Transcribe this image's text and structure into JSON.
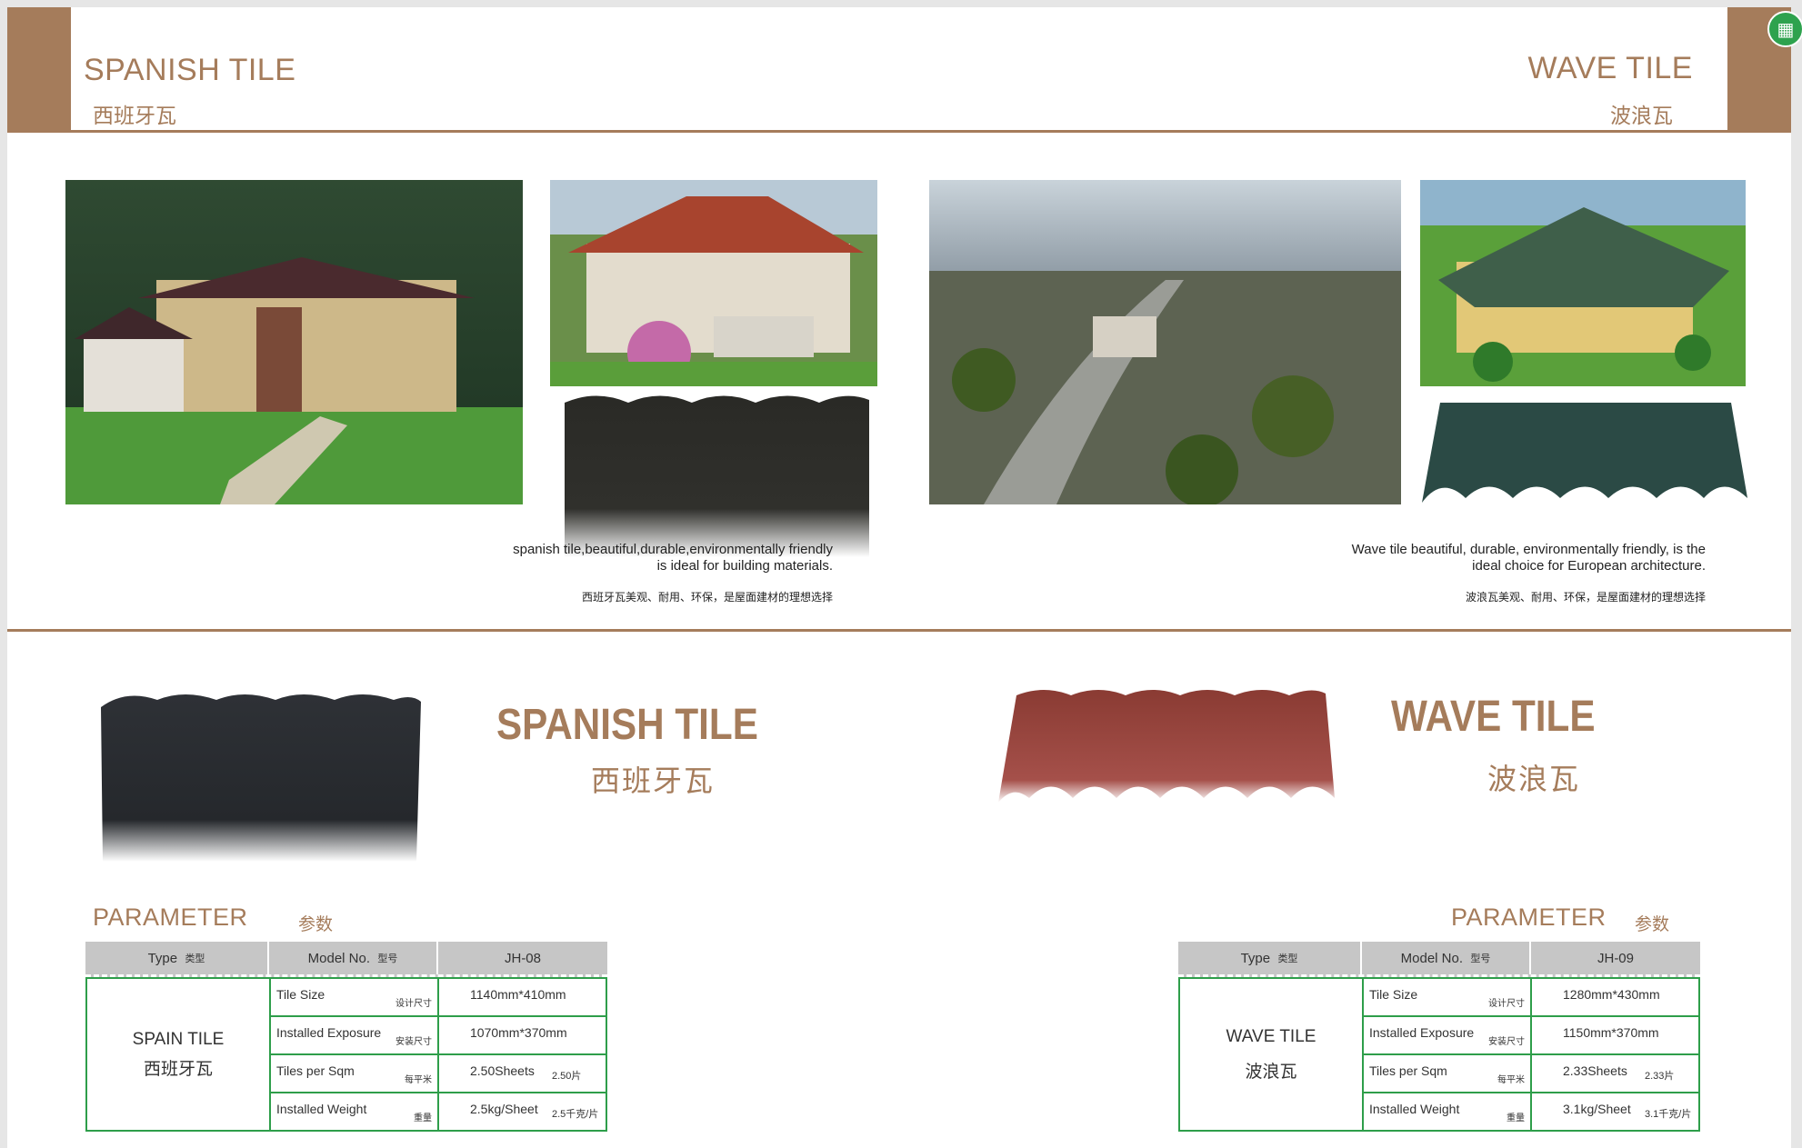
{
  "header": {
    "left_title_en": "SPANISH TILE",
    "left_title_cn": "西班牙瓦",
    "right_title_en": "WAVE TILE",
    "right_title_cn": "波浪瓦"
  },
  "captions": {
    "spanish_en_1": "spanish tile,beautiful,durable,environmentally friendly",
    "spanish_en_2": "is ideal for building materials.",
    "spanish_cn": "西班牙瓦美观、耐用、环保，是屋面建材的理想选择",
    "wave_en_1": "Wave tile beautiful, durable, environmentally friendly, is the",
    "wave_en_2": "ideal choice for European architecture.",
    "wave_cn": "波浪瓦美观、耐用、环保，是屋面建材的理想选择"
  },
  "products": {
    "spanish": {
      "title_en": "SPANISH TILE",
      "title_cn": "西班牙瓦"
    },
    "wave": {
      "title_en": "WAVE TILE",
      "title_cn": "波浪瓦"
    }
  },
  "param_label": {
    "en": "PARAMETER",
    "cn": "参数"
  },
  "table_headers": {
    "type_en": "Type",
    "type_cn": "类型",
    "model_en": "Model No.",
    "model_cn": "型号"
  },
  "spanish_table": {
    "model": "JH-08",
    "type_en": "SPAIN TILE",
    "type_cn": "西班牙瓦",
    "rows": [
      {
        "label_en": "Tile Size",
        "label_cn": "设计尺寸",
        "value": "1140mm*410mm",
        "value_cn": ""
      },
      {
        "label_en": "Installed Exposure",
        "label_cn": "安装尺寸",
        "value": "1070mm*370mm",
        "value_cn": ""
      },
      {
        "label_en": "Tiles per Sqm",
        "label_cn": "每平米",
        "value": "2.50Sheets",
        "value_cn": "2.50片"
      },
      {
        "label_en": "Installed Weight",
        "label_cn": "重量",
        "value": "2.5kg/Sheet",
        "value_cn": "2.5千克/片"
      }
    ]
  },
  "wave_table": {
    "model": "JH-09",
    "type_en": "WAVE TILE",
    "type_cn": "波浪瓦",
    "rows": [
      {
        "label_en": "Tile Size",
        "label_cn": "设计尺寸",
        "value": "1280mm*430mm",
        "value_cn": ""
      },
      {
        "label_en": "Installed Exposure",
        "label_cn": "安装尺寸",
        "value": "1150mm*370mm",
        "value_cn": ""
      },
      {
        "label_en": "Tiles per Sqm",
        "label_cn": "每平米",
        "value": "2.33Sheets",
        "value_cn": "2.33片"
      },
      {
        "label_en": "Installed Weight",
        "label_cn": "重量",
        "value": "3.1kg/Sheet",
        "value_cn": "3.1千克/片"
      }
    ]
  },
  "colors": {
    "accent": "#a57c5b",
    "table_border": "#2e9e4a",
    "table_head": "#c6c6c6"
  },
  "icons": {
    "corner": "table-view-icon"
  }
}
